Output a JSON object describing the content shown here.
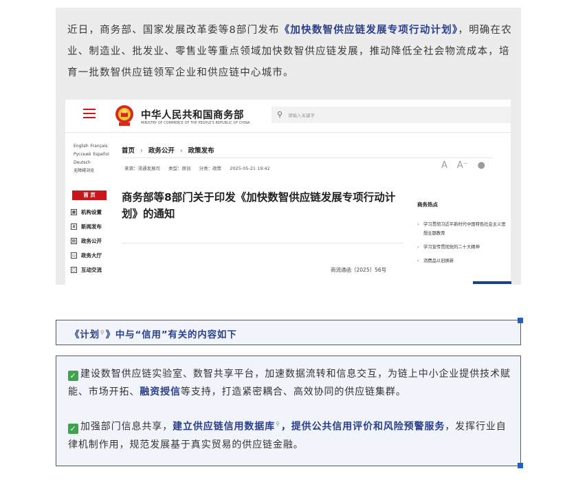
{
  "intro": {
    "before": "近日，商务部、国家发展改革委等8部门发布",
    "highlight": "《加快数智供应链发展专项行动计划》",
    "after": "，明确在农业、制造业、批发业、零售业等重点领域加快数智供应链发展，推动降低全社会物流成本，培育一批数智供应链领军企业和供应链中心城市。"
  },
  "screenshot": {
    "site_title": "中华人民共和国商务部",
    "site_subtitle": "MINISTRY OF COMMERCE OF THE PEOPLE'S REPUBLIC OF CHINA",
    "search_placeholder": "请输入关键字",
    "languages": [
      "English",
      "Français",
      "Русский",
      "Español",
      "Deutsch",
      "无障碍浏览"
    ],
    "nav_home": "首 页",
    "nav_items": [
      {
        "label": "机构设置",
        "icon": "org-icon"
      },
      {
        "label": "新闻发布",
        "icon": "news-icon"
      },
      {
        "label": "政务公开",
        "icon": "doc-icon"
      },
      {
        "label": "政务大厅",
        "icon": "hall-icon"
      },
      {
        "label": "互动交流",
        "icon": "chat-icon"
      }
    ],
    "breadcrumb": [
      "首页",
      "政务公开",
      "政策发布"
    ],
    "meta": {
      "source": "来源：流通发展司",
      "type": "类型：原创",
      "category": "分类：政策",
      "date": "2025-05-21 19:42"
    },
    "tools": {
      "font_large": "A",
      "font_small": "A⁻",
      "wechat": "微信"
    },
    "article_title": "商务部等8部门关于印发《加快数智供应链发展专项行动计划》的通知",
    "doc_number": "商流通函〔2025〕56号",
    "hot_title": "商务热点",
    "hot_items": [
      "学习贯彻习近平新时代中国特色社会主义思想主题教育",
      "学习宣传贯彻党的二十大精神",
      "消费品以旧换新"
    ]
  },
  "section": {
    "heading_part1": "《计划",
    "heading_part2": "》中与“信用”有关的内容如下"
  },
  "content": {
    "p1_before": "建设数智供应链实验室、数智共享平台，加速数据流转和信息交互，为链上中小企业提供技术赋能、市场开拓、",
    "p1_highlight": "融资授信",
    "p1_after": "等支持，打造紧密耦合、高效协同的供应链集群。",
    "p2_before": "加强部门信息共享，",
    "p2_highlight1": "建立供应链信用数据库",
    "p2_mid": "，",
    "p2_highlight2": "提供公共信用评价和风险预警服务",
    "p2_after": "，发挥行业自律机制作用，规范发展基于真实贸易的供应链金融。"
  },
  "colors": {
    "accent": "#2b3f8c",
    "brand_red": "#c8161d",
    "check_green": "#3fa34d",
    "border": "#3a5ba8"
  }
}
